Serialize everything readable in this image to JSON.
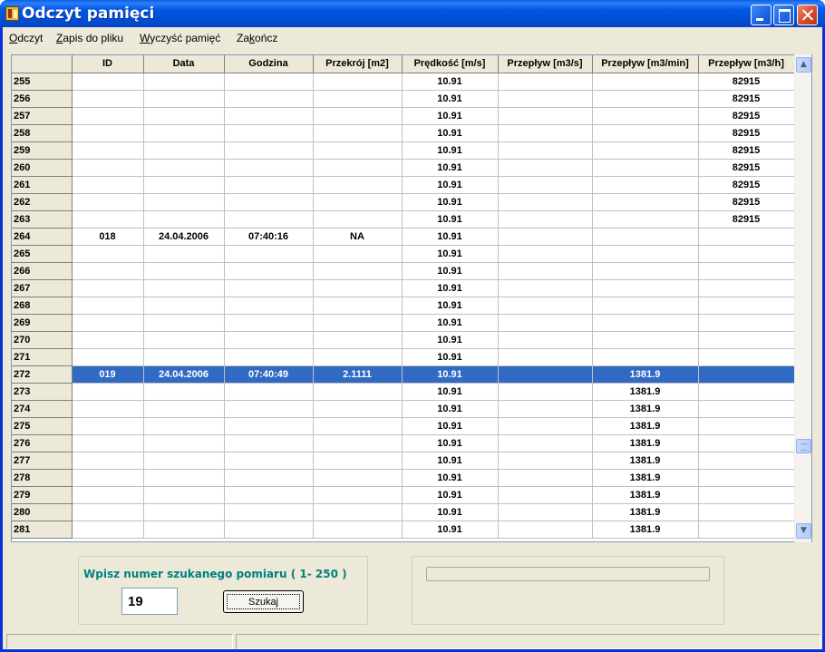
{
  "window": {
    "title": "Odczyt pamięci"
  },
  "menu": [
    {
      "underline": "O",
      "rest": "dczyt"
    },
    {
      "underline": "Z",
      "rest": "apis do pliku"
    },
    {
      "underline": "W",
      "rest": "yczyść pamięć"
    },
    {
      "pre": "Za",
      "underline": "k",
      "rest": "ończ"
    }
  ],
  "grid": {
    "columns": [
      "",
      "ID",
      "Data",
      "Godzina",
      "Przekrój [m2]",
      "Prędkość [m/s]",
      "Przepływ [m3/s]",
      "Przepływ [m3/min]",
      "Przepływ [m3/h]"
    ],
    "selected_row": "272",
    "rows": [
      [
        "255",
        "",
        "",
        "",
        "",
        "10.91",
        "",
        "",
        "82915"
      ],
      [
        "256",
        "",
        "",
        "",
        "",
        "10.91",
        "",
        "",
        "82915"
      ],
      [
        "257",
        "",
        "",
        "",
        "",
        "10.91",
        "",
        "",
        "82915"
      ],
      [
        "258",
        "",
        "",
        "",
        "",
        "10.91",
        "",
        "",
        "82915"
      ],
      [
        "259",
        "",
        "",
        "",
        "",
        "10.91",
        "",
        "",
        "82915"
      ],
      [
        "260",
        "",
        "",
        "",
        "",
        "10.91",
        "",
        "",
        "82915"
      ],
      [
        "261",
        "",
        "",
        "",
        "",
        "10.91",
        "",
        "",
        "82915"
      ],
      [
        "262",
        "",
        "",
        "",
        "",
        "10.91",
        "",
        "",
        "82915"
      ],
      [
        "263",
        "",
        "",
        "",
        "",
        "10.91",
        "",
        "",
        "82915"
      ],
      [
        "264",
        "018",
        "24.04.2006",
        "07:40:16",
        "NA",
        "10.91",
        "",
        "",
        ""
      ],
      [
        "265",
        "",
        "",
        "",
        "",
        "10.91",
        "",
        "",
        ""
      ],
      [
        "266",
        "",
        "",
        "",
        "",
        "10.91",
        "",
        "",
        ""
      ],
      [
        "267",
        "",
        "",
        "",
        "",
        "10.91",
        "",
        "",
        ""
      ],
      [
        "268",
        "",
        "",
        "",
        "",
        "10.91",
        "",
        "",
        ""
      ],
      [
        "269",
        "",
        "",
        "",
        "",
        "10.91",
        "",
        "",
        ""
      ],
      [
        "270",
        "",
        "",
        "",
        "",
        "10.91",
        "",
        "",
        ""
      ],
      [
        "271",
        "",
        "",
        "",
        "",
        "10.91",
        "",
        "",
        ""
      ],
      [
        "272",
        "019",
        "24.04.2006",
        "07:40:49",
        "2.1111",
        "10.91",
        "",
        "1381.9",
        ""
      ],
      [
        "273",
        "",
        "",
        "",
        "",
        "10.91",
        "",
        "1381.9",
        ""
      ],
      [
        "274",
        "",
        "",
        "",
        "",
        "10.91",
        "",
        "1381.9",
        ""
      ],
      [
        "275",
        "",
        "",
        "",
        "",
        "10.91",
        "",
        "1381.9",
        ""
      ],
      [
        "276",
        "",
        "",
        "",
        "",
        "10.91",
        "",
        "1381.9",
        ""
      ],
      [
        "277",
        "",
        "",
        "",
        "",
        "10.91",
        "",
        "1381.9",
        ""
      ],
      [
        "278",
        "",
        "",
        "",
        "",
        "10.91",
        "",
        "1381.9",
        ""
      ],
      [
        "279",
        "",
        "",
        "",
        "",
        "10.91",
        "",
        "1381.9",
        ""
      ],
      [
        "280",
        "",
        "",
        "",
        "",
        "10.91",
        "",
        "1381.9",
        ""
      ],
      [
        "281",
        "",
        "",
        "",
        "",
        "10.91",
        "",
        "1381.9",
        ""
      ]
    ]
  },
  "search": {
    "label": "Wpisz numer szukanego pomiaru ( 1- 250 )",
    "value": "19",
    "button_label": "Szukaj"
  },
  "colors": {
    "title_bar": "#0054e3",
    "selection": "#316ac5",
    "search_label": "#008080"
  },
  "icons": [
    "app-icon",
    "minimize-icon",
    "maximize-icon",
    "close-icon",
    "scroll-up-icon",
    "scroll-down-icon"
  ]
}
